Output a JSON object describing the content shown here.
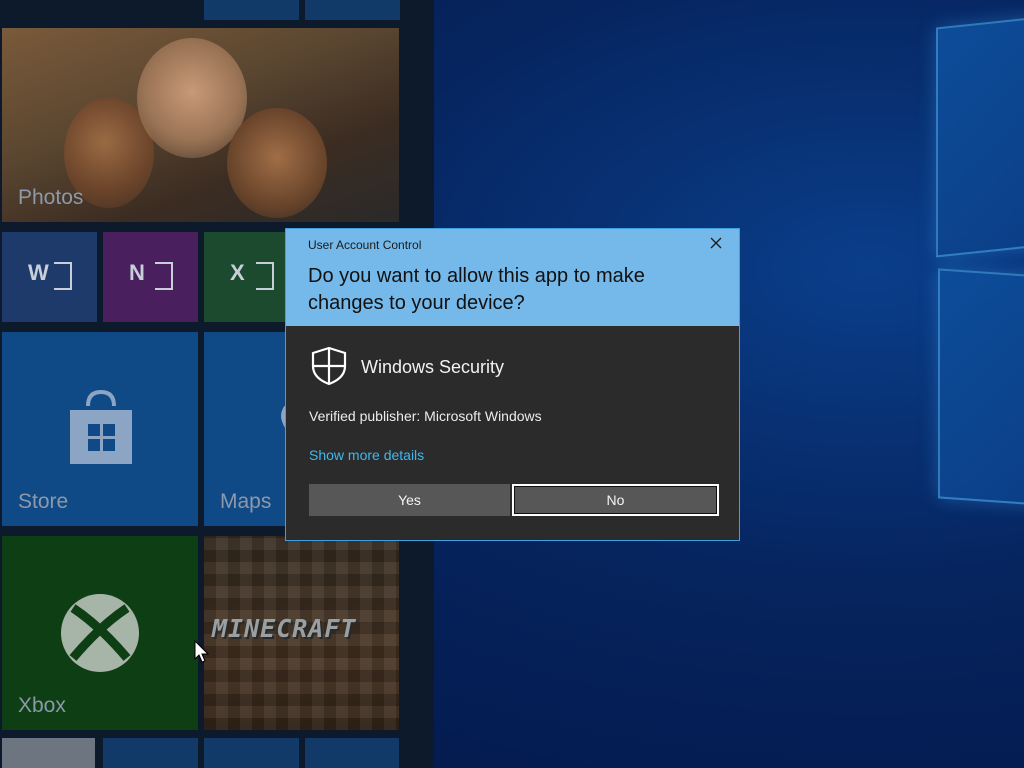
{
  "dialog": {
    "title": "User Account Control",
    "question": "Do you want to allow this app to make changes to your device?",
    "app_name": "Windows Security",
    "publisher": "Verified publisher: Microsoft Windows",
    "details_link": "Show more details",
    "yes_label": "Yes",
    "no_label": "No",
    "close_icon": "close-icon",
    "app_icon": "shield-icon",
    "header_color": "#75b9ea",
    "body_color": "#2b2b2b",
    "link_color": "#3fb8ef"
  },
  "start_tiles": {
    "photos": "Photos",
    "store": "Store",
    "maps": "Maps",
    "xbox": "Xbox",
    "minecraft": "MINECRAFT",
    "word_glyph": "W",
    "onenote_glyph": "N",
    "excel_glyph": "X",
    "store_icon": "shopping-bag-icon",
    "xbox_icon": "xbox-logo-icon"
  },
  "desktop": {
    "wallpaper": "windows-logo-wallpaper",
    "cursor_icon": "mouse-pointer-icon"
  }
}
